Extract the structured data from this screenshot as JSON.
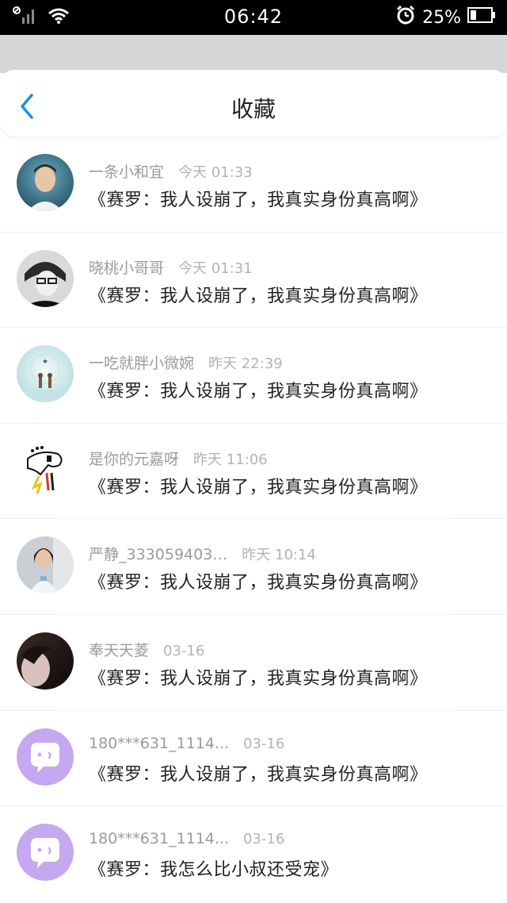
{
  "status_bar": {
    "time": "06:42",
    "battery_percent": "25%"
  },
  "header": {
    "title": "收藏"
  },
  "items": [
    {
      "name": "一条小和宜",
      "time": "今天 01:33",
      "message": "《赛罗：我人设崩了，我真实身份真高啊》",
      "avatar": "photo-boy-blue"
    },
    {
      "name": "晓桃小哥哥",
      "time": "今天 01:31",
      "message": "《赛罗：我人设崩了，我真实身份真高啊》",
      "avatar": "photo-bw-glasses"
    },
    {
      "name": "一吃就胖小微婉",
      "time": "昨天 22:39",
      "message": "《赛罗：我人设崩了，我真实身份真高啊》",
      "avatar": "illustration-couple"
    },
    {
      "name": "是你的元嘉呀",
      "time": "昨天 11:06",
      "message": "《赛罗：我人设崩了，我真实身份真高啊》",
      "avatar": "drawing-rooster"
    },
    {
      "name": "严静_333059403…",
      "time": "昨天 10:14",
      "message": "《赛罗：我人设崩了，我真实身份真高啊》",
      "avatar": "photo-girl"
    },
    {
      "name": "奉天天菱",
      "time": "03-16",
      "message": "《赛罗：我人设崩了，我真实身份真高啊》",
      "avatar": "photo-dark-portrait"
    },
    {
      "name": "180***631_1114...",
      "time": "03-16",
      "message": "《赛罗：我人设崩了，我真实身份真高啊》",
      "avatar": "default-chat-bubble"
    },
    {
      "name": "180***631_1114...",
      "time": "03-16",
      "message": "《赛罗：我怎么比小叔还受宠》",
      "avatar": "default-chat-bubble"
    }
  ],
  "colors": {
    "accent_blue": "#1f8ee6",
    "default_avatar_purple": "#c5a8f0"
  }
}
